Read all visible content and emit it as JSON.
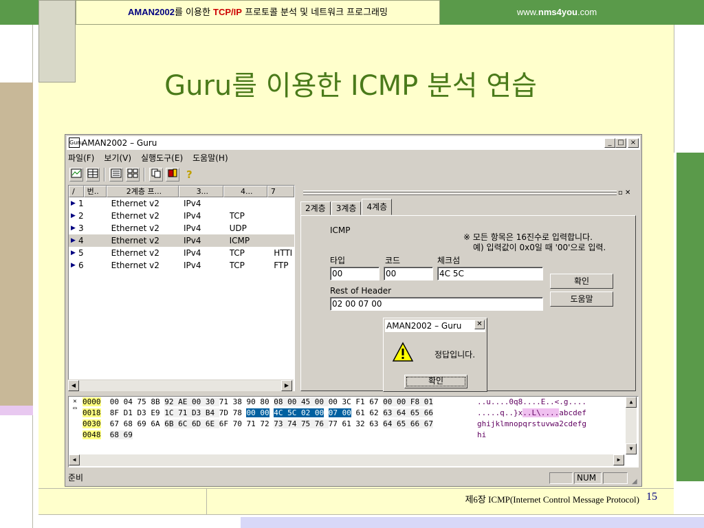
{
  "slide": {
    "header": {
      "brand": "AMAN2002",
      "mid1": "를 이용한 ",
      "proto": "TCP/IP",
      "mid2": " 프로토콜 분석 및 네트워크 프로그래밍"
    },
    "site": {
      "pre": "www.",
      "bold": "nms4you",
      "post": ".com"
    },
    "title": "Guru를 이용한 ICMP 분석 연습",
    "footer": "제6장  ICMP(Internet Control Message Protocol)",
    "page": "15",
    "colors": {
      "accent_green": "#4a7a1a",
      "header_navy": "#000080",
      "deco_green": "#5a9a4a",
      "deco_tan": "#c8b898"
    }
  },
  "window": {
    "title": "AMAN2002 – Guru",
    "controls": [
      "_",
      "□",
      "×"
    ],
    "menu": [
      "파일(F)",
      "보기(V)",
      "실행도구(E)",
      "도움말(H)"
    ],
    "toolbar_icons": [
      "chart-icon",
      "grid-icon",
      "list-icon",
      "table-icon",
      "copy-icon",
      "book-icon",
      "help-icon"
    ],
    "list": {
      "columns": [
        "번..",
        "2계층 프...",
        "3...",
        "4...",
        "7"
      ],
      "rows": [
        {
          "n": "1",
          "l2": "Ethernet v2",
          "l3": "IPv4",
          "l4": "",
          "l7": ""
        },
        {
          "n": "2",
          "l2": "Ethernet v2",
          "l3": "IPv4",
          "l4": "TCP",
          "l7": ""
        },
        {
          "n": "3",
          "l2": "Ethernet v2",
          "l3": "IPv4",
          "l4": "UDP",
          "l7": ""
        },
        {
          "n": "4",
          "l2": "Ethernet v2",
          "l3": "IPv4",
          "l4": "ICMP",
          "l7": ""
        },
        {
          "n": "5",
          "l2": "Ethernet v2",
          "l3": "IPv4",
          "l4": "TCP",
          "l7": "HTTI"
        },
        {
          "n": "6",
          "l2": "Ethernet v2",
          "l3": "IPv4",
          "l4": "TCP",
          "l7": "FTP"
        }
      ]
    },
    "tabs": [
      "2계층",
      "3계층",
      "4계층"
    ],
    "form": {
      "section": "ICMP",
      "note1": "※ 모든 항목은 16진수로 입력합니다.",
      "note2": "예) 입력값이 0x0일 때 '00'으로 입력.",
      "type_label": "타입",
      "type_value": "00",
      "code_label": "코드",
      "code_value": "00",
      "checksum_label": "체크섬",
      "checksum_value": "4C 5C",
      "rest_label": "Rest of Header",
      "rest_value": "02 00 07 00",
      "ok_button": "확인",
      "help_button": "도움말"
    },
    "dialog": {
      "title": "AMAN2002 – Guru",
      "message": "정답입니다.",
      "ok": "확인"
    },
    "hex": {
      "rows": [
        {
          "off": "0000",
          "a": "00 04 75 8B ",
          "b": "92 AE 00 30 ",
          "c": "71 38 90 80 ",
          "d": "08 00 45 00 ",
          "e": "00 3C F1 67 ",
          "f": "00 00 F8 01",
          "ascii": "..u....0q8....E..<.g...."
        },
        {
          "off": "0018",
          "a": "8F D1 D3 E9 ",
          "b": "1C 71 D3 B4 ",
          "c": "7D 78 ",
          "c2": "00 00",
          "d": "4C 5C 02 00",
          "e": "07 00",
          "e2": " 61 62 ",
          "f": "63 64 65 66",
          "ascii_pre": ".....q..}x",
          "ascii_hl": "..L\\....",
          "ascii_post": "abcdef"
        },
        {
          "off": "0030",
          "a": "67 68 69 6A ",
          "b": "6B 6C 6D 6E ",
          "c": "6F 70 71 72 ",
          "d": "73 74 75 76 ",
          "e": "77 61 32 63 ",
          "f": "64 65 66 67",
          "ascii": "ghijklmnopqrstuvwa2cdefg"
        },
        {
          "off": "0048",
          "a": "68 69",
          "ascii": "hi"
        }
      ]
    },
    "status": {
      "text": "준비",
      "num": "NUM"
    }
  }
}
